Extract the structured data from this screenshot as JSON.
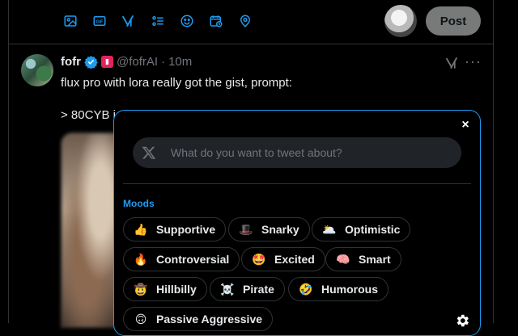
{
  "composer": {
    "tools": [
      {
        "icon": "image-icon"
      },
      {
        "icon": "gif-icon"
      },
      {
        "icon": "grok-icon"
      },
      {
        "icon": "poll-icon"
      },
      {
        "icon": "emoji-icon"
      },
      {
        "icon": "schedule-icon"
      },
      {
        "icon": "location-icon"
      }
    ],
    "gif_label": "GIF",
    "post_label": "Post"
  },
  "tweet": {
    "name": "fofr",
    "handle": "@fofrAI",
    "separator": "·",
    "time": "10m",
    "text1": "flux pro with lora really got the gist, prompt:",
    "text2": "> 80CYB i"
  },
  "popup": {
    "close_label": "×",
    "prompt_placeholder": "What do you want to tweet about?",
    "moods_title": "Moods",
    "moods": [
      {
        "label": "Supportive",
        "emoji": "👍"
      },
      {
        "label": "Snarky",
        "emoji": "🎩"
      },
      {
        "label": "Optimistic",
        "emoji": "🌥️"
      },
      {
        "label": "Controversial",
        "emoji": "🔥"
      },
      {
        "label": "Excited",
        "emoji": "🤩"
      },
      {
        "label": "Smart",
        "emoji": "🧠"
      },
      {
        "label": "Hillbilly",
        "emoji": "🤠"
      },
      {
        "label": "Pirate",
        "emoji": "☠️"
      },
      {
        "label": "Humorous",
        "emoji": "🤣"
      },
      {
        "label": "Passive Aggressive",
        "emoji": "🙃"
      }
    ]
  },
  "colors": {
    "accent": "#1d9bf0",
    "background": "#000000",
    "border": "#2f3336",
    "muted": "#71767b"
  }
}
